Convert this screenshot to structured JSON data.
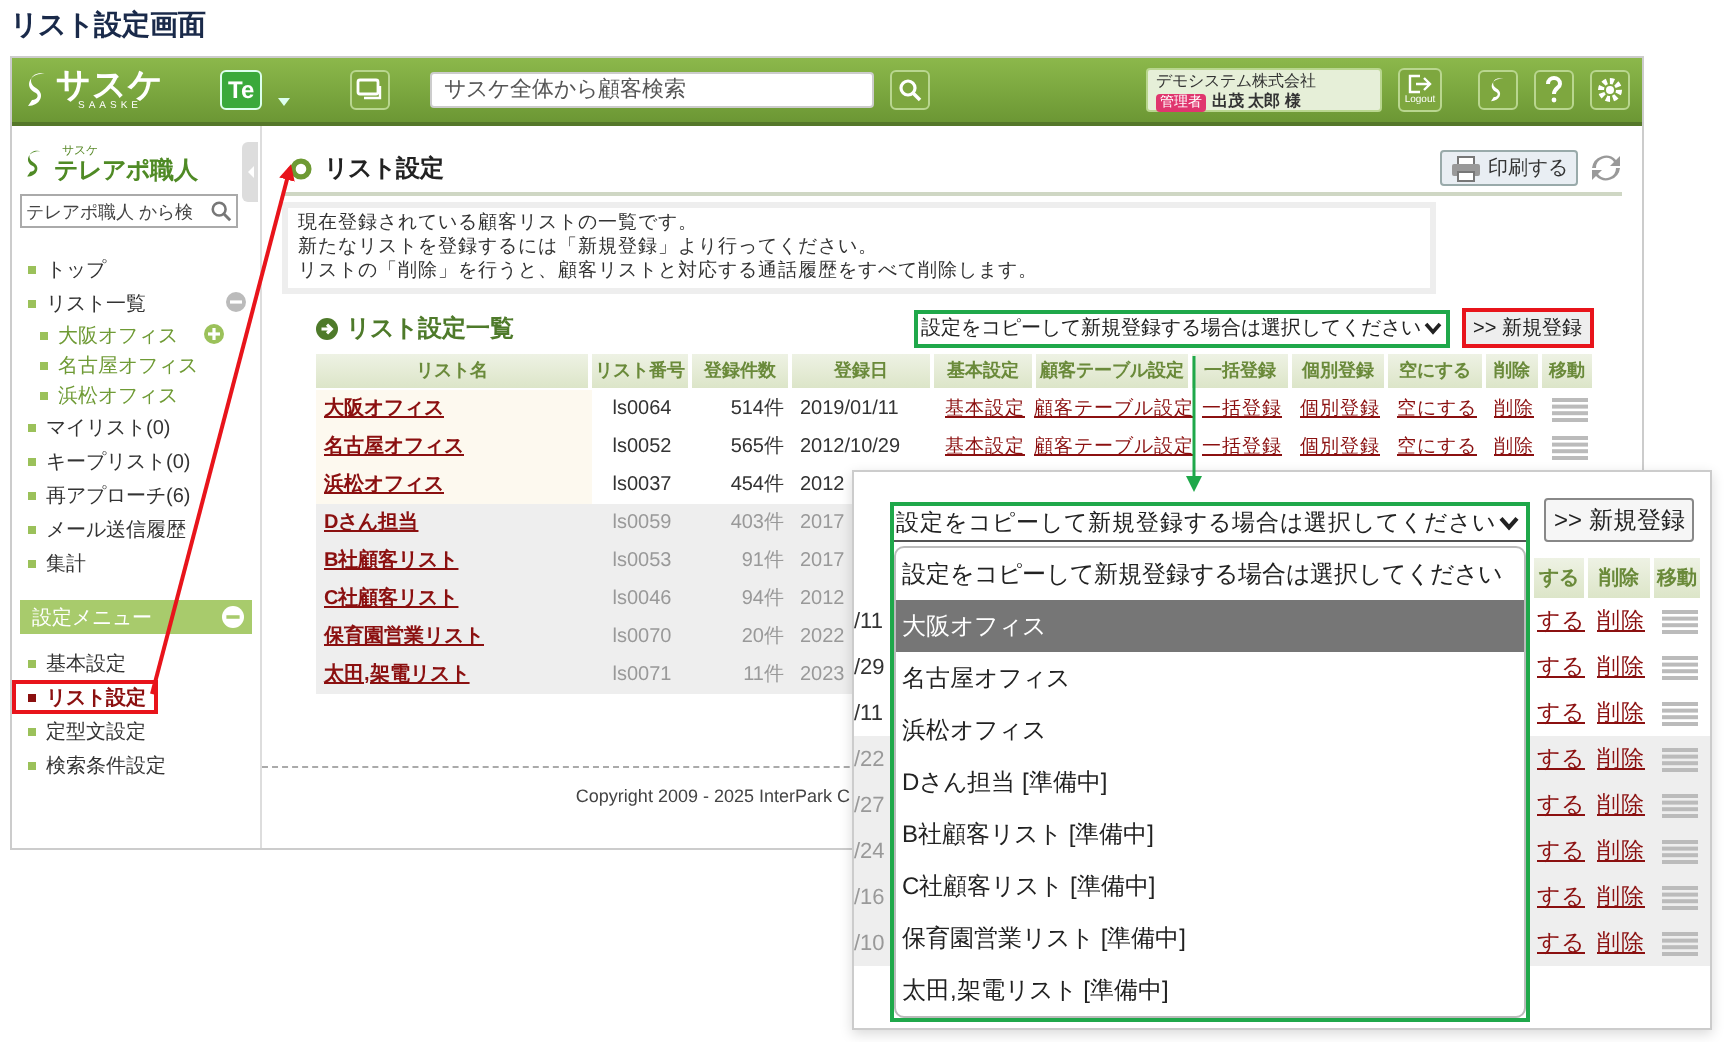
{
  "page_title": "リスト設定画面",
  "header": {
    "logo": "サスケ",
    "logo_sub": "SAASKE",
    "app_badge": "Te",
    "search": {
      "placeholder": "サスケ全体から顧客検索"
    },
    "user": {
      "company": "デモシステム株式会社",
      "role": "管理者",
      "name": "出茂 太郎 様"
    },
    "logout": "Logout"
  },
  "sidebar": {
    "logo_sub": "サスケ",
    "logo": "テレアポ職人",
    "search": {
      "placeholder": "テレアポ職人 から検"
    },
    "items": [
      {
        "label": "トップ",
        "selected": false
      },
      {
        "label": "リスト一覧",
        "selected": false,
        "expanded": true,
        "children": [
          {
            "label": "大阪オフィス",
            "selected": false
          },
          {
            "label": "名古屋オフィス",
            "selected": false
          },
          {
            "label": "浜松オフィス",
            "selected": false
          }
        ]
      },
      {
        "label": "マイリスト(0)",
        "selected": false
      },
      {
        "label": "キープリスト(0)",
        "selected": false
      },
      {
        "label": "再アプローチ(6)",
        "selected": false
      },
      {
        "label": "メール送信履歴",
        "selected": false
      },
      {
        "label": "集計",
        "selected": false
      }
    ],
    "settings": {
      "title": "設定メニュー",
      "expanded": true,
      "items": [
        {
          "label": "基本設定",
          "selected": false,
          "callout": false
        },
        {
          "label": "リスト設定",
          "selected": true,
          "callout": true
        },
        {
          "label": "定型文設定",
          "selected": false,
          "callout": false
        },
        {
          "label": "検索条件設定",
          "selected": false,
          "callout": false
        }
      ]
    }
  },
  "main": {
    "title": "リスト設定",
    "print_button": "印刷する",
    "info": [
      "現在登録されている顧客リストの一覧です。",
      "新たなリストを登録するには「新規登録」より行ってください。",
      "リストの「削除」を行うと、顧客リストと対応する通話履歴をすべて削除します。"
    ],
    "list_heading": "リスト設定一覧",
    "copy_select": {
      "value": "設定をコピーして新規登録する場合は選択してください",
      "callout": true
    },
    "new_button": {
      "label": ">> 新規登録",
      "callout": true
    },
    "table": {
      "columns": [
        "リスト名",
        "リスト番号",
        "登録件数",
        "登録日",
        "基本設定",
        "顧客テーブル設定",
        "一括登録",
        "個別登録",
        "空にする",
        "削除",
        "移動"
      ],
      "rows": [
        {
          "ready": true,
          "cells": [
            "大阪オフィス",
            "ls0064",
            "514件",
            "2019/01/11",
            "基本設定",
            "顧客テーブル設定",
            "一括登録",
            "個別登録",
            "空にする",
            "削除"
          ]
        },
        {
          "ready": true,
          "cells": [
            "名古屋オフィス",
            "ls0052",
            "565件",
            "2012/10/29",
            "基本設定",
            "顧客テーブル設定",
            "一括登録",
            "個別登録",
            "空にする",
            "削除"
          ]
        },
        {
          "ready": true,
          "cells": [
            "浜松オフィス",
            "ls0037",
            "454件",
            "2012"
          ]
        },
        {
          "ready": false,
          "cells": [
            "Dさん担当",
            "ls0059",
            "403件",
            "2017"
          ]
        },
        {
          "ready": false,
          "cells": [
            "B社顧客リスト",
            "ls0053",
            "91件",
            "2017"
          ]
        },
        {
          "ready": false,
          "cells": [
            "C社顧客リスト",
            "ls0046",
            "94件",
            "2012"
          ]
        },
        {
          "ready": false,
          "cells": [
            "保育園営業リスト",
            "ls0070",
            "20件",
            "2022"
          ]
        },
        {
          "ready": false,
          "cells": [
            "太田,架電リスト",
            "ls0071",
            "11件",
            "2023"
          ]
        }
      ]
    },
    "footer": "Copyright 2009 - 2025 InterPark C"
  },
  "inset": {
    "select": {
      "value": "設定をコピーして新規登録する場合は選択してください",
      "callout": true
    },
    "options": [
      {
        "label": "設定をコピーして新規登録する場合は選択してください",
        "selected": false
      },
      {
        "label": "大阪オフィス",
        "selected": true
      },
      {
        "label": "名古屋オフィス",
        "selected": false
      },
      {
        "label": "浜松オフィス",
        "selected": false
      },
      {
        "label": "Dさん担当 [準備中]",
        "selected": false
      },
      {
        "label": "B社顧客リスト [準備中]",
        "selected": false
      },
      {
        "label": "C社顧客リスト [準備中]",
        "selected": false
      },
      {
        "label": "保育園営業リスト [準備中]",
        "selected": false
      },
      {
        "label": "太田,架電リスト [準備中]",
        "selected": false
      }
    ],
    "new_button": ">> 新規登録",
    "columns": [
      "する",
      "削除",
      "移動"
    ],
    "rows": [
      {
        "ready": true,
        "date_tail": "/11",
        "empty_link": "する",
        "delete_link": "削除"
      },
      {
        "ready": true,
        "date_tail": "/29",
        "empty_link": "する",
        "delete_link": "削除"
      },
      {
        "ready": true,
        "date_tail": "/11",
        "empty_link": "する",
        "delete_link": "削除"
      },
      {
        "ready": false,
        "date_tail": "/22",
        "empty_link": "する",
        "delete_link": "削除"
      },
      {
        "ready": false,
        "date_tail": "/27",
        "empty_link": "する",
        "delete_link": "削除"
      },
      {
        "ready": false,
        "date_tail": "/24",
        "empty_link": "する",
        "delete_link": "削除"
      },
      {
        "ready": false,
        "date_tail": "/16",
        "empty_link": "する",
        "delete_link": "削除"
      },
      {
        "ready": false,
        "date_tail": "/10",
        "empty_link": "する",
        "delete_link": "削除"
      }
    ]
  }
}
